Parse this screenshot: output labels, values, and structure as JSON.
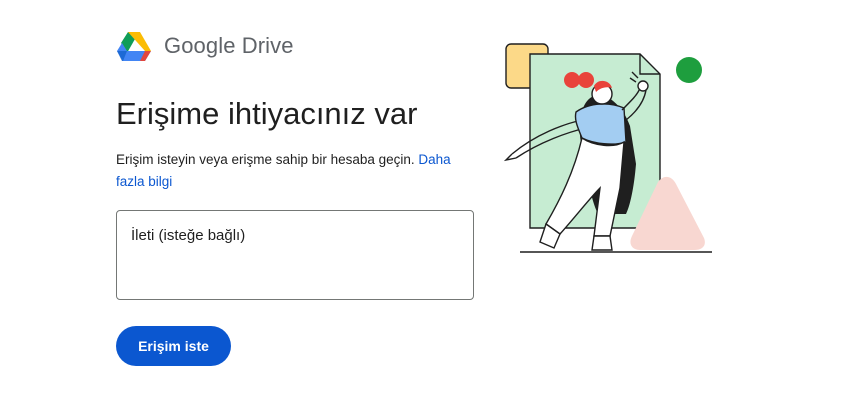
{
  "brand": {
    "product_name": "Google Drive",
    "logo_icon": "google-drive-logo",
    "colors": {
      "green": "#0f9d58",
      "blue": "#4285f4",
      "yellow": "#fbbc04",
      "red": "#ea4335"
    }
  },
  "main": {
    "title": "Erişime ihtiyacınız var",
    "description": "Erişim isteyin veya erişme sahip bir hesaba geçin.",
    "learn_more_link": "Daha fazla bilgi",
    "message_placeholder": "İleti (isteğe bağlı)",
    "request_button_label": "Erişim iste"
  },
  "theme": {
    "primary": "#0b57d0",
    "text": "#1f1f1f",
    "muted": "#5f6368",
    "border": "#747775"
  },
  "illustration": {
    "icon": "access-request-illustration",
    "colors": {
      "document": "#c6ecd2",
      "sticky": "#fcd988",
      "circle": "#1e9e3e",
      "triangle": "#f8d7d1",
      "hair": "#e9433b",
      "shirt": "#a3cdf2"
    }
  }
}
